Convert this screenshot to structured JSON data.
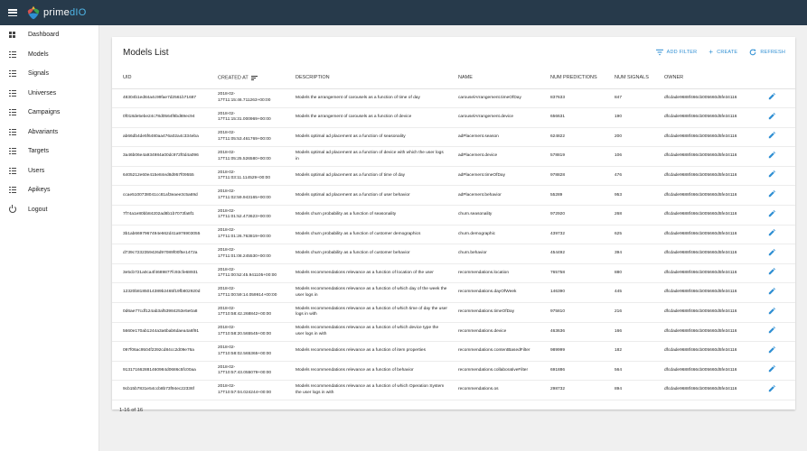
{
  "app": {
    "name_prefix": "prime",
    "name_suffix": "dIO"
  },
  "sidebar": {
    "items": [
      {
        "label": "Dashboard",
        "icon": "dashboard-icon"
      },
      {
        "label": "Models",
        "icon": "list-icon"
      },
      {
        "label": "Signals",
        "icon": "list-icon"
      },
      {
        "label": "Universes",
        "icon": "list-icon"
      },
      {
        "label": "Campaigns",
        "icon": "list-icon"
      },
      {
        "label": "Abvariants",
        "icon": "list-icon"
      },
      {
        "label": "Targets",
        "icon": "list-icon"
      },
      {
        "label": "Users",
        "icon": "list-icon"
      },
      {
        "label": "Apikeys",
        "icon": "list-icon"
      },
      {
        "label": "Logout",
        "icon": "power-icon"
      }
    ]
  },
  "main": {
    "title": "Models List",
    "actions": {
      "add_filter": "ADD FILTER",
      "create": "CREATE",
      "refresh": "REFRESH"
    },
    "columns": [
      "UID",
      "CREATED AT",
      "DESCRIPTION",
      "NAME",
      "NUM PREDICTIONS",
      "NUM SIGNALS",
      "OWNER"
    ],
    "rows": [
      {
        "uid": "48304b1ed84a4c99fae7d2561b71687",
        "created_line1": "2018-02-",
        "created_line2": "17T11:15:46.711263+00:00",
        "description": "Models the arrangement of carousels as a function of time of day",
        "name": "carouselArrangement.timeOfDay",
        "num_predictions": "837633",
        "num_signals": "847",
        "owner": "dfcdade9688f466cb005660d5fe34116"
      },
      {
        "uid": "0f018de5ebe24c78d0564f8bd69ec94",
        "created_line1": "2018-02-",
        "created_line2": "17T11:15:31.000969+00:00",
        "description": "Models the arrangement of carousels as a function of device",
        "name": "carouselArrangement.device",
        "num_predictions": "656631",
        "num_signals": "190",
        "owner": "dfcdade9688f466cb005660d5fe34116"
      },
      {
        "uid": "ab66db4de5f6480aa476a02a4c334eba",
        "created_line1": "2018-02-",
        "created_line2": "17T11:05:53.461769+00:00",
        "description": "Models optimal ad placement as a function of seasonality",
        "name": "adPlacement.season",
        "num_predictions": "624822",
        "num_signals": "200",
        "owner": "dfcdade9688f466cb005660d5fe34116"
      },
      {
        "uid": "3a46b06e4a934984a00dc972f0d4a096",
        "created_line1": "2018-02-",
        "created_line2": "17T11:05:25.526580+00:00",
        "description": "Models optimal ad placement as a function of device with which the user logs in",
        "name": "adPlacement.device",
        "num_predictions": "578819",
        "num_signals": "106",
        "owner": "dfcdade9688f466cb005660d5fe34116"
      },
      {
        "uid": "6405212e60e415e84ed8d957f09555",
        "created_line1": "2018-02-",
        "created_line2": "17T11:03:11.114529+00:00",
        "description": "Models optimal ad placement as a function of time of day",
        "name": "adPlacement.timeOfDay",
        "num_predictions": "978828",
        "num_signals": "476",
        "owner": "dfcdade9688f466cb005660d5fe34116"
      },
      {
        "uid": "ccae5100738041cc81af3eaee3c5a69d",
        "created_line1": "2018-02-",
        "created_line2": "17T11:02:59.943165+00:00",
        "description": "Models optimal ad placement as a function of user behavior",
        "name": "adPlacement.behavior",
        "num_predictions": "55289",
        "num_signals": "953",
        "owner": "dfcdade9688f466cb005660d5fe34116"
      },
      {
        "uid": "7f74a1e80bb84202ad8b1b7073fa8f1",
        "created_line1": "2018-02-",
        "created_line2": "17T11:01:52.473623+00:00",
        "description": "Models churn probability as a function of seasonality",
        "name": "churn.seasonality",
        "num_predictions": "972920",
        "num_signals": "268",
        "owner": "dfcdade9688f466cb005660d5fe34116"
      },
      {
        "uid": "3b1ab6697967494e662d41a976903055",
        "created_line1": "2018-02-",
        "created_line2": "17T11:01:26.763819+00:00",
        "description": "Models churn probability as a function of customer demographics",
        "name": "churn.demographic",
        "num_predictions": "439732",
        "num_signals": "625",
        "owner": "dfcdade9688f466cb005660d5fe34116"
      },
      {
        "uid": "d739c7232359426d97089f00f5e1472a",
        "created_line1": "2018-02-",
        "created_line2": "17T11:01:08.245530+00:00",
        "description": "Models churn probability as a function of customer behavior",
        "name": "churn.behavior",
        "num_predictions": "454492",
        "num_signals": "394",
        "owner": "dfcdade9688f466cb005660d5fe34116"
      },
      {
        "uid": "3e5cb721a0ca4f4689877fc93cfe68931",
        "created_line1": "2018-02-",
        "created_line2": "17T11:00:52:45.941105+00:00",
        "description": "Models recommendations relevance as a function of location of the user",
        "name": "recommendations.location",
        "num_predictions": "765758",
        "num_signals": "880",
        "owner": "dfcdade9688f466cb005660d5fe34116"
      },
      {
        "uid": "12320b8185014389b2465f19fb802920d",
        "created_line1": "2018-02-",
        "created_line2": "17T11:00:59:14.059914+00:00",
        "description": "Models recommendations relevance as a function of which day of the week the user logs in",
        "name": "recommendations.dayOfWeek",
        "num_predictions": "146390",
        "num_signals": "445",
        "owner": "dfcdade9688f466cb005660d5fe34116"
      },
      {
        "uid": "0d6ae77cdf124ab3af53984253e5e0a8",
        "created_line1": "2018-02-",
        "created_line2": "17T10:58:42.268842+00:00",
        "description": "Models recommendations relevance as a function of which time of day the user logs in with",
        "name": "recommendations.timeOfDay",
        "num_predictions": "975810",
        "num_signals": "216",
        "owner": "dfcdade9688f466cb005660d5fe34116"
      },
      {
        "uid": "5660e170ab1244a3a6bab6daea4a6f91",
        "created_line1": "2018-02-",
        "created_line2": "17T10:58:20.565545+00:00",
        "description": "Models recommendations relevance as a function of which device type the user logs in with",
        "name": "recommendations.device",
        "num_predictions": "463636",
        "num_signals": "166",
        "owner": "dfcdade9688f466cb005660d5fe34116"
      },
      {
        "uid": "097f06ac9504f2392cd84cc2d09e76a",
        "created_line1": "2018-02-",
        "created_line2": "17T10:58:02.565365+00:00",
        "description": "Models recommendations relevance as a function of item properties",
        "name": "recommendations.contentBasedFilter",
        "num_predictions": "989999",
        "num_signals": "182",
        "owner": "dfcdade9688f466cb005660d5fe34116"
      },
      {
        "uid": "913171662881460984d0686c5fc00aa",
        "created_line1": "2018-02-",
        "created_line2": "17T10:57:43.055079+00:00",
        "description": "Models recommendations relevance as a function of behavior",
        "name": "recommendations.collaborativeFilter",
        "num_predictions": "691886",
        "num_signals": "564",
        "owner": "dfcdade9688f466cb005660d5fe34116"
      },
      {
        "uid": "9cb15b7831e54ccb8b73f94ec22336f",
        "created_line1": "2018-02-",
        "created_line2": "17T10:57:04.024244+00:00",
        "description": "Models recommendations relevance as a function of which Operation System the user logs in with",
        "name": "recommendations.os",
        "num_predictions": "298732",
        "num_signals": "894",
        "owner": "dfcdade9688f466cb005660d5fe34116"
      }
    ],
    "pagination": "1-16 of 16"
  },
  "colors": {
    "topbar": "#273a4b",
    "accent": "#2f8fd3",
    "background": "#f0f0f0"
  }
}
